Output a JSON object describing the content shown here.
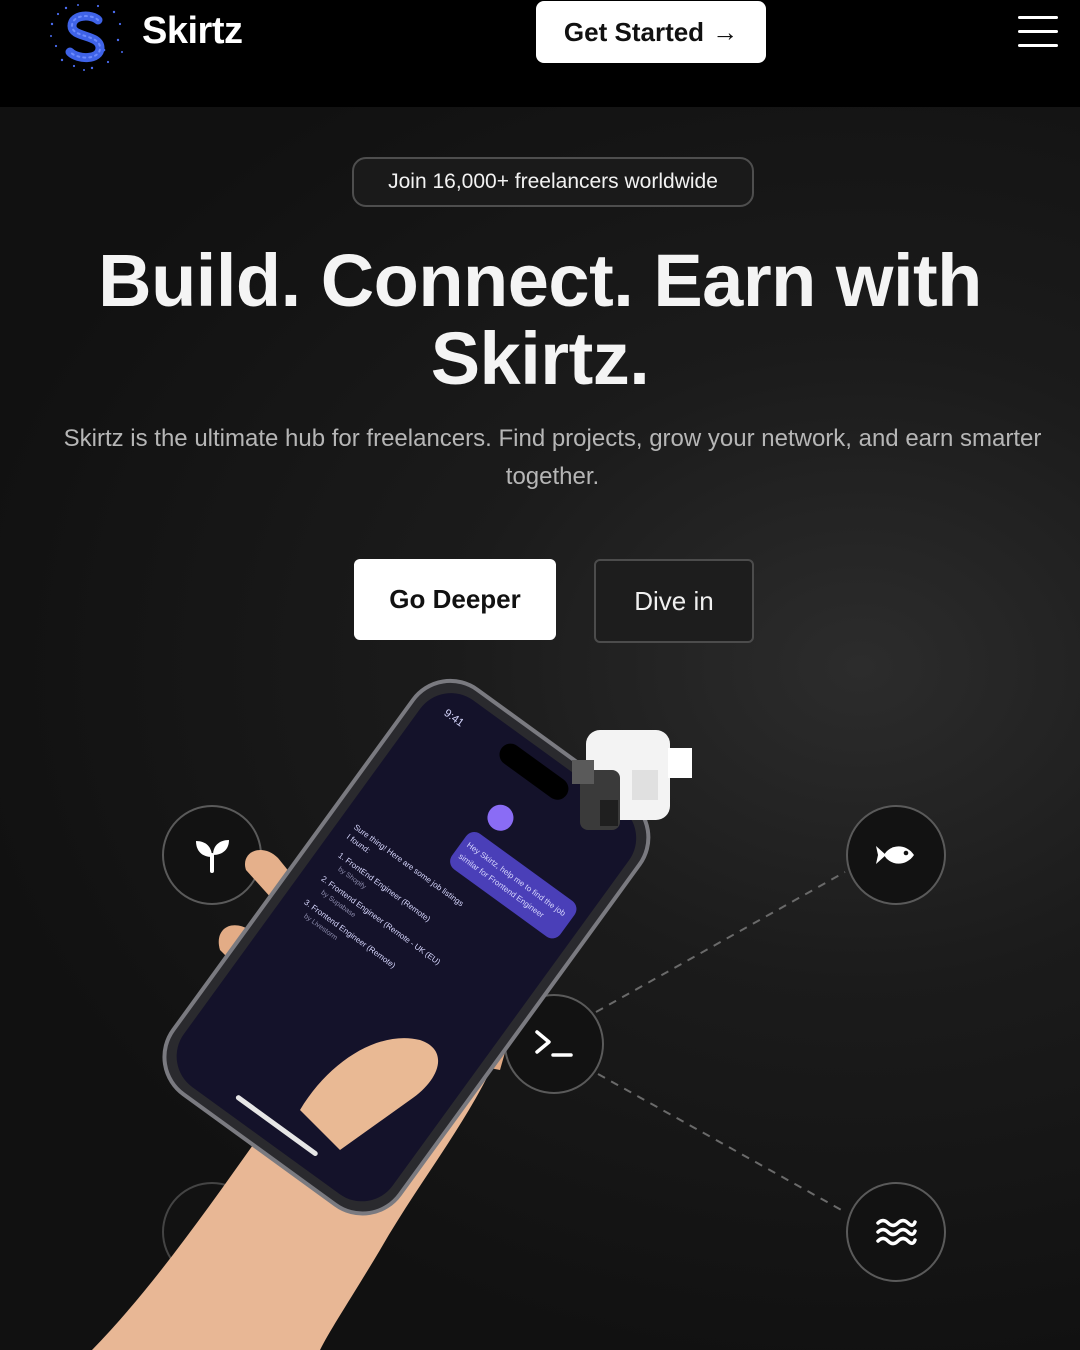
{
  "header": {
    "brand": "Skirtz",
    "logo_letter": "S",
    "cta_label": "Get Started",
    "cta_arrow": "→"
  },
  "hero": {
    "badge": "Join 16,000+ freelancers worldwide",
    "headline_line1": "Build. Connect. Earn with",
    "headline_line2": "Skirtz.",
    "subtitle_line1": "Skirtz is the ultimate hub for freelancers. Find projects, grow your network, and earn smarter",
    "subtitle_line2": "together.",
    "primary_button": "Go Deeper",
    "secondary_button": "Dive in"
  },
  "phone": {
    "time": "9:41",
    "user_message_line1": "Hey Skirtz, help me to find the job",
    "user_message_line2": "similar for Frontend Engineer",
    "reply_line1": "Sure thing! Here are some job listings",
    "reply_line2": "I found:",
    "listings": [
      {
        "title": "1. FrontEnd Engineer (Remote)",
        "company": "by Shopify"
      },
      {
        "title": "2. Frontend Engineer (Remote - UK (EU)",
        "company": "by Supabase"
      },
      {
        "title": "3. Frontend Engineer (Remote)",
        "company": "by Livestorm"
      }
    ]
  },
  "nodes": [
    "sprout-icon",
    "fish-icon",
    "terminal-icon",
    "waves-icon"
  ],
  "colors": {
    "header_bg": "#000000",
    "page_bg": "#161616",
    "logo_blue": "#3f63e8",
    "button_bg": "#ffffff"
  }
}
